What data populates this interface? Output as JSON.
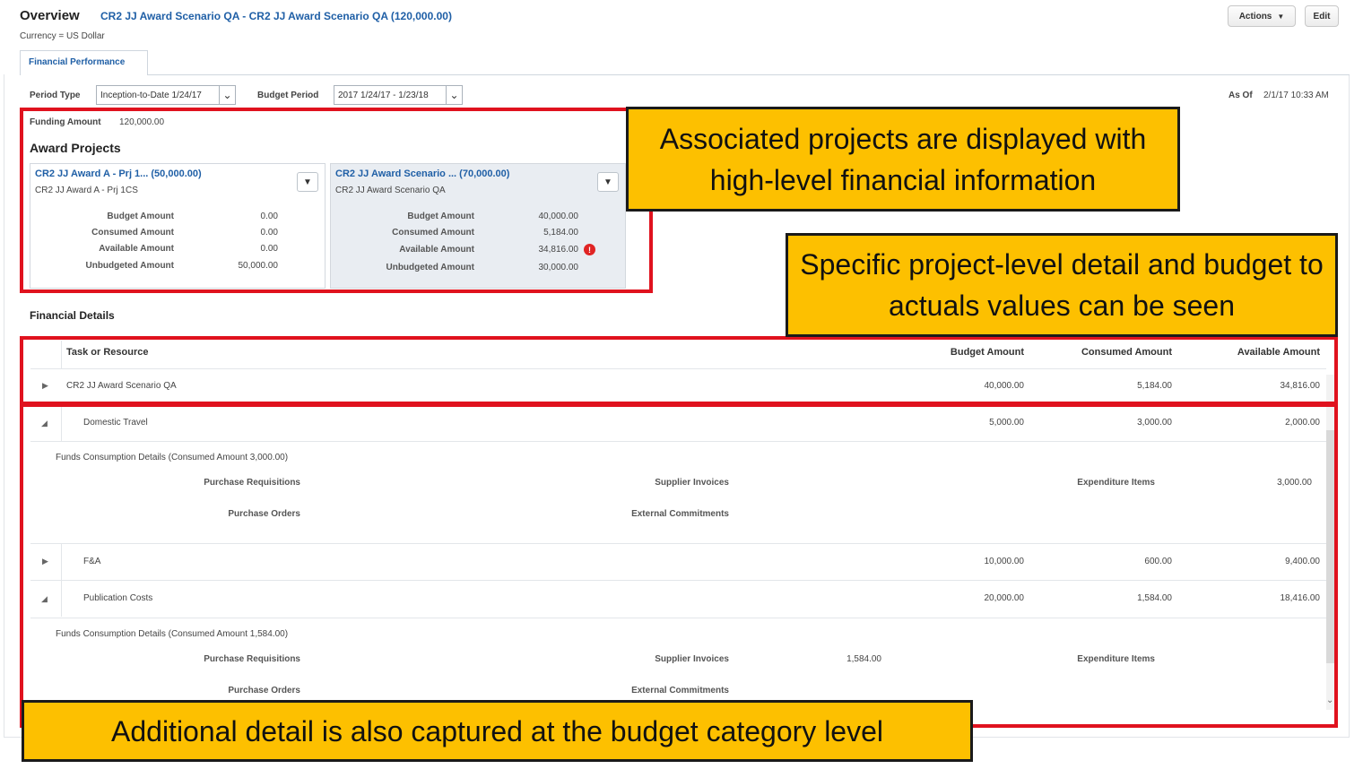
{
  "header": {
    "title": "Overview",
    "subtitle": "CR2 JJ Award Scenario QA - CR2 JJ Award Scenario QA (120,000.00)",
    "currency": "Currency = US Dollar",
    "actions_label": "Actions",
    "edit_label": "Edit"
  },
  "tabs": [
    {
      "label": "Financial Performance"
    }
  ],
  "filters": {
    "period_type_label": "Period Type",
    "period_type_value": "Inception-to-Date 1/24/17",
    "budget_period_label": "Budget Period",
    "budget_period_value": "2017 1/24/17 - 1/23/18",
    "as_of_label": "As Of",
    "as_of_value": "2/1/17 10:33 AM"
  },
  "funding": {
    "label": "Funding Amount",
    "value": "120,000.00"
  },
  "award_projects": {
    "title": "Award Projects",
    "cards": [
      {
        "title": "CR2 JJ Award A - Prj 1... (50,000.00)",
        "subtitle": "CR2 JJ Award A - Prj 1CS",
        "rows": [
          {
            "label": "Budget Amount",
            "value": "0.00"
          },
          {
            "label": "Consumed Amount",
            "value": "0.00"
          },
          {
            "label": "Available Amount",
            "value": "0.00"
          },
          {
            "label": "Unbudgeted Amount",
            "value": "50,000.00"
          }
        ]
      },
      {
        "title": "CR2 JJ Award Scenario ... (70,000.00)",
        "subtitle": "CR2 JJ Award Scenario QA",
        "rows": [
          {
            "label": "Budget Amount",
            "value": "40,000.00"
          },
          {
            "label": "Consumed Amount",
            "value": "5,184.00"
          },
          {
            "label": "Available Amount",
            "value": "34,816.00"
          },
          {
            "label": "Unbudgeted Amount",
            "value": "30,000.00"
          }
        ]
      }
    ]
  },
  "financial_details": {
    "title": "Financial Details",
    "columns": [
      "Task or Resource",
      "Budget Amount",
      "Consumed Amount",
      "Available Amount"
    ],
    "rows": [
      {
        "name": "CR2 JJ Award Scenario QA",
        "budget": "40,000.00",
        "consumed": "5,184.00",
        "available": "34,816.00"
      },
      {
        "name": "Domestic Travel",
        "budget": "5,000.00",
        "consumed": "3,000.00",
        "available": "2,000.00"
      },
      {
        "name": "F&A",
        "budget": "10,000.00",
        "consumed": "600.00",
        "available": "9,400.00"
      },
      {
        "name": "Publication Costs",
        "budget": "20,000.00",
        "consumed": "1,584.00",
        "available": "18,416.00"
      }
    ],
    "detail_1": {
      "title": "Funds Consumption Details (Consumed Amount 3,000.00)",
      "purchase_requisitions": "Purchase Requisitions",
      "supplier_invoices": "Supplier Invoices",
      "expenditure_items": "Expenditure Items",
      "expenditure_value": "3,000.00",
      "purchase_orders": "Purchase Orders",
      "external_commitments": "External Commitments"
    },
    "detail_2": {
      "title": "Funds Consumption Details (Consumed Amount 1,584.00)",
      "purchase_requisitions": "Purchase Requisitions",
      "supplier_invoices": "Supplier Invoices",
      "supplier_value": "1,584.00",
      "expenditure_items": "Expenditure Items",
      "purchase_orders": "Purchase Orders",
      "external_commitments": "External Commitments"
    }
  },
  "callouts": {
    "c1": "Associated projects are displayed with high-level financial information",
    "c2": "Specific project-level detail and budget to actuals values can be seen",
    "c3": "Additional detail is also captured at the budget category level"
  },
  "colors": {
    "link_blue": "#1f5fa6",
    "highlight_red": "#e0121e",
    "callout_yellow": "#fdc000"
  },
  "icons": {
    "actions_dropdown": "caret-down-icon",
    "select_dropdown": "chevron-down-icon",
    "warning": "exclamation-circle-icon",
    "expand": "triangle-right-icon",
    "collapse": "triangle-down-icon"
  }
}
